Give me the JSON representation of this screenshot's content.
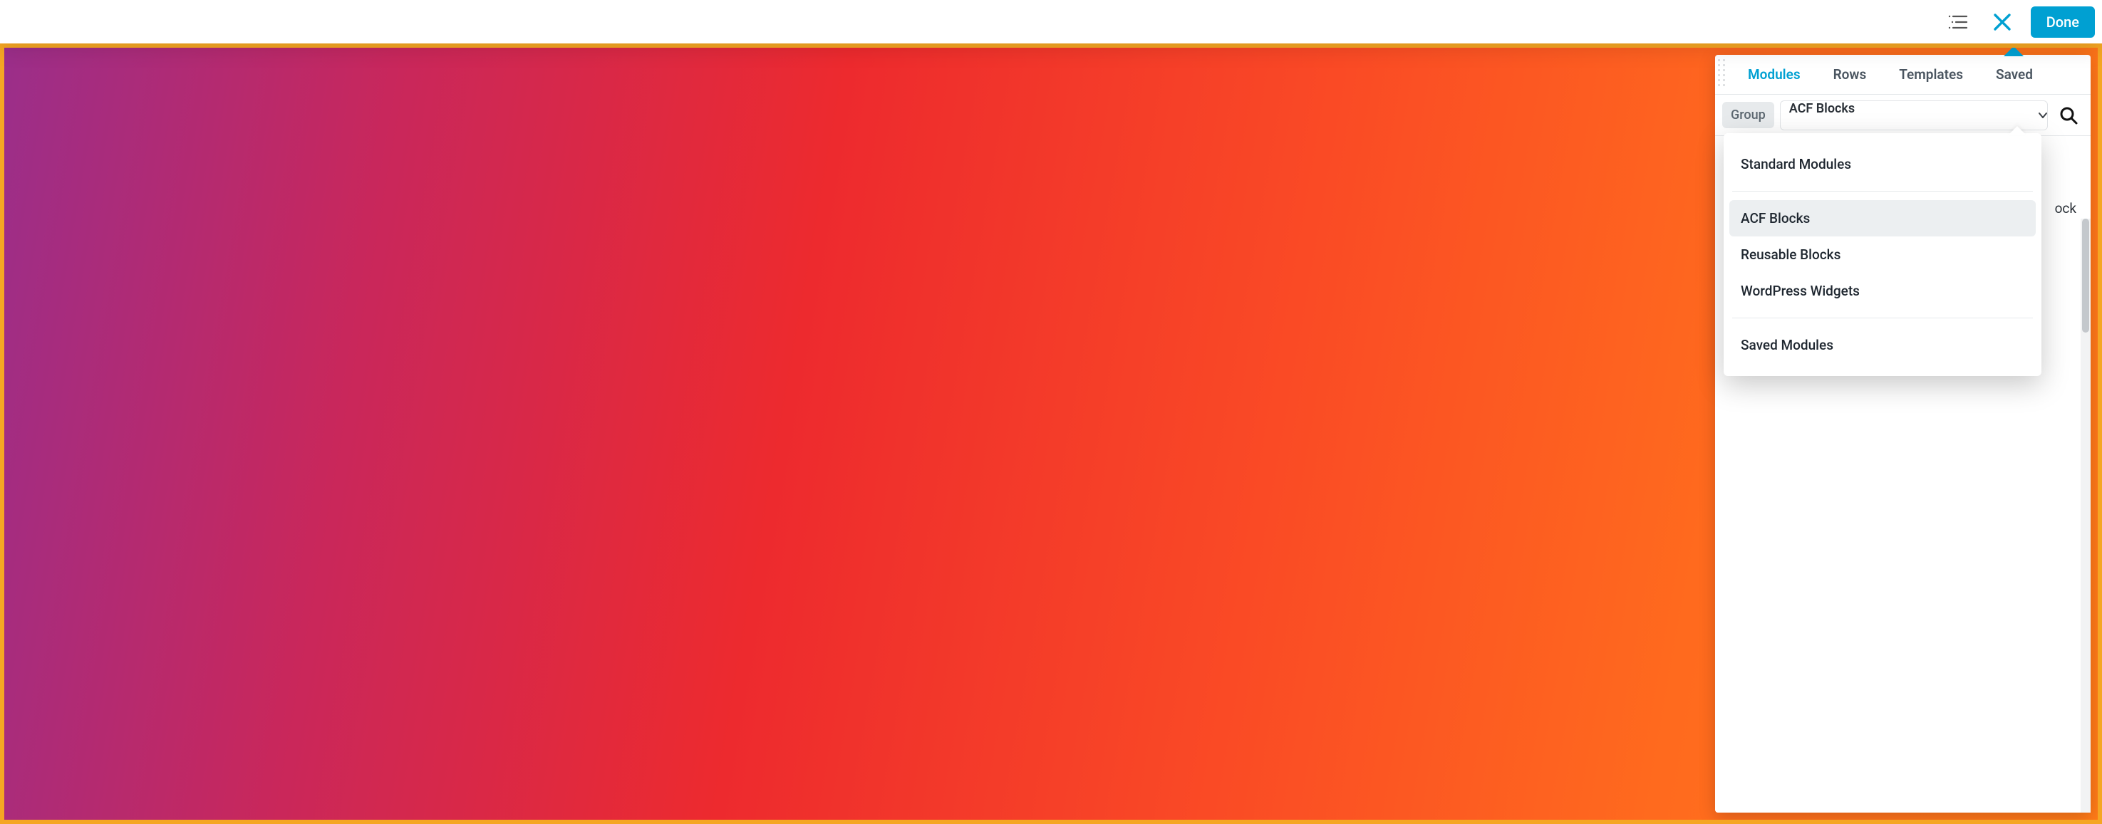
{
  "topbar": {
    "done_label": "Done"
  },
  "panel": {
    "tabs": [
      {
        "label": "Modules",
        "active": true
      },
      {
        "label": "Rows"
      },
      {
        "label": "Templates"
      },
      {
        "label": "Saved"
      }
    ],
    "group": {
      "chip_label": "Group",
      "selected": "ACF Blocks",
      "options": [
        {
          "label": "Standard Modules"
        },
        {
          "label": "ACF Blocks",
          "selected": true
        },
        {
          "label": "Reusable Blocks"
        },
        {
          "label": "WordPress Widgets"
        },
        {
          "label": "Saved Modules",
          "separated": true
        }
      ]
    },
    "partially_hidden_text": "ock"
  }
}
